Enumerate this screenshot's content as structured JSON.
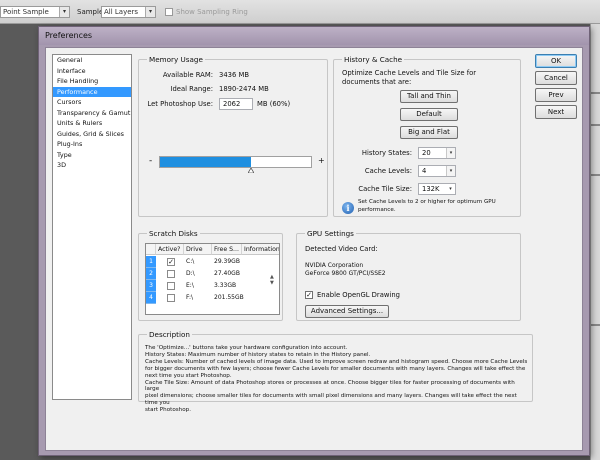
{
  "options_bar": {
    "point_sample": "Point Sample",
    "sample_label": "Sample:",
    "sample_value": "All Layers",
    "show_ring_label": "Show Sampling Ring"
  },
  "dialog": {
    "title": "Preferences",
    "sidebar": [
      {
        "label": "General"
      },
      {
        "label": "Interface"
      },
      {
        "label": "File Handling"
      },
      {
        "label": "Performance",
        "selected": true
      },
      {
        "label": "Cursors"
      },
      {
        "label": "Transparency & Gamut"
      },
      {
        "label": "Units & Rulers"
      },
      {
        "label": "Guides, Grid & Slices"
      },
      {
        "label": "Plug-Ins"
      },
      {
        "label": "Type"
      },
      {
        "label": "3D"
      }
    ],
    "buttons": {
      "ok": "OK",
      "cancel": "Cancel",
      "prev": "Prev",
      "next": "Next"
    },
    "memory": {
      "title": "Memory Usage",
      "available_label": "Available RAM:",
      "available_value": "3436 MB",
      "ideal_label": "Ideal Range:",
      "ideal_value": "1890-2474 MB",
      "let_label": "Let Photoshop Use:",
      "let_value": "2062",
      "let_unit": "MB (60%)",
      "slider_fraction": 0.6,
      "minus": "-",
      "plus": "+"
    },
    "history": {
      "title": "History & Cache",
      "line1": "Optimize Cache Levels and Tile Size for",
      "line2": "documents that are:",
      "tall_thin": "Tall and Thin",
      "default": "Default",
      "big_flat": "Big and Flat",
      "states_label": "History States:",
      "states_value": "20",
      "levels_label": "Cache Levels:",
      "levels_value": "4",
      "tile_label": "Cache Tile Size:",
      "tile_value": "132K",
      "info_line1": "Set Cache Levels to 2 or higher for optimum GPU",
      "info_line2": "performance."
    },
    "scratch": {
      "title": "Scratch Disks",
      "columns": [
        "Active?",
        "Drive",
        "Free S...",
        "Information"
      ],
      "rows": [
        {
          "num": "1",
          "active": true,
          "drive": "C:\\",
          "free": "29.39GB"
        },
        {
          "num": "2",
          "active": false,
          "drive": "D:\\",
          "free": "27.40GB"
        },
        {
          "num": "3",
          "active": false,
          "drive": "E:\\",
          "free": "3.33GB"
        },
        {
          "num": "4",
          "active": false,
          "drive": "F:\\",
          "free": "201.55GB"
        }
      ]
    },
    "gpu": {
      "title": "GPU Settings",
      "detected_label": "Detected Video Card:",
      "vendor": "NVIDIA Corporation",
      "model": "GeForce 9800 GT/PCI/SSE2",
      "opengl_label": "Enable OpenGL Drawing",
      "opengl_checked": true,
      "advanced_button": "Advanced Settings..."
    },
    "description": {
      "title": "Description",
      "lines": [
        "The 'Optimize...' buttons take your hardware configuration into account.",
        "History States: Maximum number of history states to retain in the History panel.",
        "Cache Levels: Number of cached levels of image data.  Used to improve screen redraw and histogram speed.  Choose more Cache Levels",
        "for bigger documents with few layers; choose fewer Cache Levels for smaller documents with many layers. Changes will take effect the",
        "next time you start Photoshop.",
        "Cache Tile Size: Amount of data Photoshop stores or processes at once. Choose bigger tiles for faster processing of documents with large",
        "pixel dimensions; choose smaller tiles for documents with small pixel dimensions and many layers. Changes will take effect the next time you",
        "start Photoshop."
      ]
    }
  }
}
